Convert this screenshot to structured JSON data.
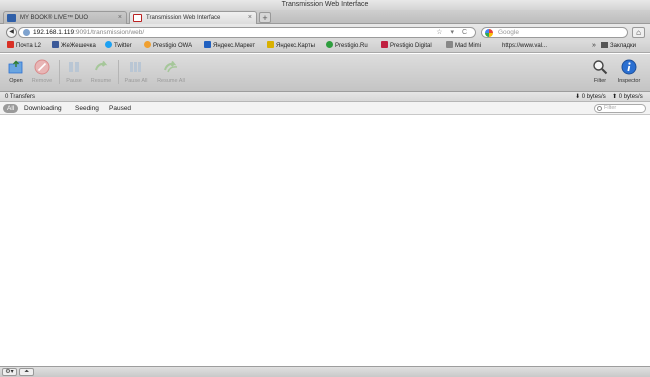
{
  "window": {
    "title": "Transmission Web Interface"
  },
  "tabs": [
    {
      "label": "MY BOOK® LIVE™ DUO",
      "icon": "wd-icon",
      "active": false
    },
    {
      "label": "Transmission Web Interface",
      "icon": "transmission-icon",
      "active": true
    }
  ],
  "nav": {
    "back_icon": "back-arrow-icon",
    "url_host": "192.168.1.119",
    "url_path": ":9091/transmission/web/",
    "url_icons": "☆ ▾ C",
    "search_placeholder": "Google",
    "home_icon": "home-icon"
  },
  "bookmarks": [
    {
      "label": "Почта L2",
      "icon": "gmail-icon",
      "color": "#d93025"
    },
    {
      "label": "ЖеЖешечка",
      "icon": "livejournal-icon",
      "color": "#3b5998"
    },
    {
      "label": "Twitter",
      "icon": "twitter-icon",
      "color": "#1da1f2"
    },
    {
      "label": "Prestigio OWA",
      "icon": "owa-icon",
      "color": "#f0a030"
    },
    {
      "label": "Яндекс.Маркет",
      "icon": "yandex-market-icon",
      "color": "#2060c0"
    },
    {
      "label": "Яндекс.Карты",
      "icon": "yandex-maps-icon",
      "color": "#d9b000"
    },
    {
      "label": "Prestigio.Ru",
      "icon": "prestigio-icon",
      "color": "#2e9e3e"
    },
    {
      "label": "Prestigio Digital",
      "icon": "prestigio-digital-icon",
      "color": "#c02040"
    },
    {
      "label": "Mad Mimi",
      "icon": "madmimi-icon",
      "color": "#888888"
    },
    {
      "label": "https://www.val...",
      "icon": "page-icon",
      "color": "#333333"
    }
  ],
  "bookmarks_more": "»",
  "bookmarks_folder": "Закладки",
  "toolbar": {
    "open": "Open",
    "remove": "Remove",
    "pause": "Pause",
    "resume": "Resume",
    "pause_all": "Pause All",
    "resume_all": "Resume All",
    "filter": "Filter",
    "inspector": "Inspector"
  },
  "status": {
    "transfers": "0 Transfers",
    "download": "0 bytes/s",
    "upload": "0 bytes/s"
  },
  "filters": {
    "tabs": [
      "All",
      "Downloading",
      "Seeding",
      "Paused"
    ],
    "active": "All",
    "search_placeholder": "Filter"
  },
  "bottombar": {
    "settings_icon": "gear-icon",
    "turtle_icon": "turtle-icon",
    "settings_glyph": "⚙▾",
    "turtle_glyph": "⏶"
  },
  "colors": {
    "accent_blue": "#2a6fd1",
    "disabled_red": "#d98a8a",
    "disabled_gray": "#a7b6c6",
    "disabled_green": "#a6c79a"
  }
}
